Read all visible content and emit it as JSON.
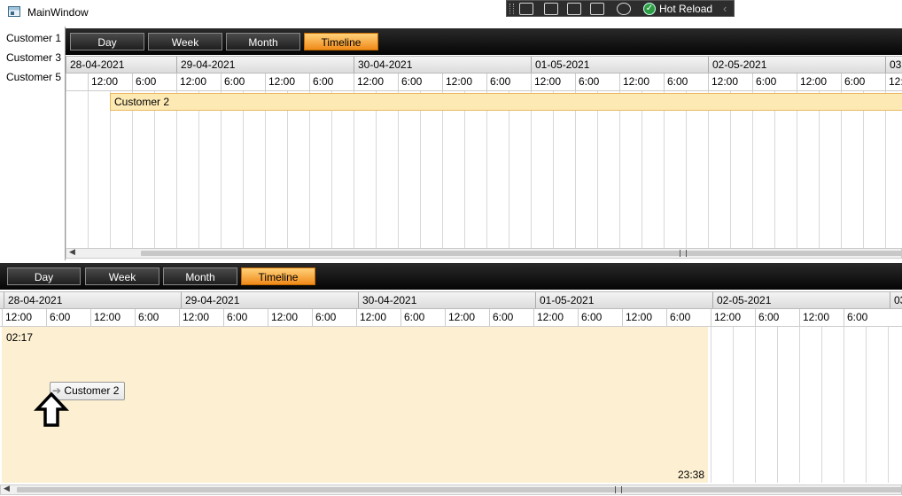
{
  "window": {
    "title": "MainWindow"
  },
  "devtools": {
    "hot_reload_label": "Hot Reload",
    "hot_reload_check": "✓"
  },
  "customers": [
    "Customer 1",
    "Customer 3",
    "Customer 5"
  ],
  "view_buttons": [
    "Day",
    "Week",
    "Month",
    "Timeline"
  ],
  "active_view": "Timeline",
  "dates": [
    "28-04-2021",
    "29-04-2021",
    "30-04-2021",
    "01-05-2021",
    "02-05-2021",
    "03"
  ],
  "time_labels": [
    "12:00",
    "6:00"
  ],
  "top_scheduler": {
    "appointment_label": "Customer 2"
  },
  "bottom_scheduler": {
    "start_time": "02:17",
    "end_time": "23:38",
    "drag_label": "Customer 2"
  },
  "colors": {
    "accent": "#f39a2a",
    "appointment": "#fde9b3",
    "toolbar": "#111111"
  }
}
